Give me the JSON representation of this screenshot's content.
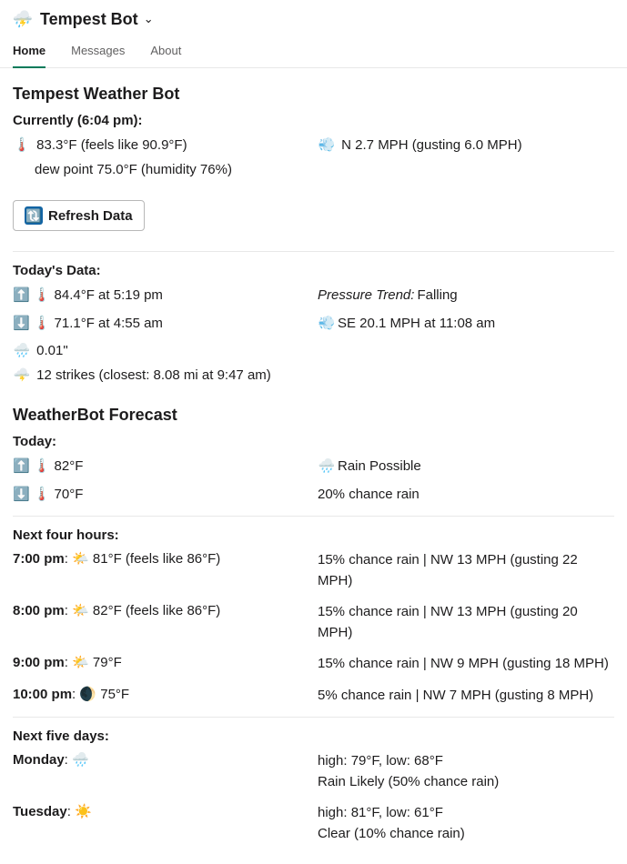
{
  "header": {
    "app_icon": "⛈️",
    "app_title": "Tempest Bot",
    "chevron": "⌄"
  },
  "tabs": [
    {
      "label": "Home",
      "active": true
    },
    {
      "label": "Messages",
      "active": false
    },
    {
      "label": "About",
      "active": false
    }
  ],
  "weather": {
    "title": "Tempest Weather Bot",
    "currently_label": "Currently (6:04 pm):",
    "current": {
      "temp_icon": "🌡️",
      "temp_line": "83.3°F (feels like 90.9°F)",
      "dew_line": "dew point 75.0°F (humidity 76%)",
      "wind_icon": "💨",
      "wind_line": "N 2.7 MPH (gusting 6.0 MPH)"
    },
    "refresh_label": "Refresh Data",
    "refresh_icon": "🔃",
    "todays_data_label": "Today's Data:",
    "today": {
      "hi_icons": "⬆️ 🌡️",
      "hi_text": "84.4°F at 5:19 pm",
      "lo_icons": "⬇️ 🌡️",
      "lo_text": "71.1°F at 4:55 am",
      "rain_icon": "🌧️",
      "rain_text": "0.01\"",
      "strike_icon": "🌩️",
      "strike_text": "12 strikes (closest: 8.08 mi at 9:47 am)",
      "pressure_label": "Pressure Trend:",
      "pressure_value": "Falling",
      "wind_icon": "💨",
      "wind_text": "SE 20.1 MPH at 11:08 am"
    }
  },
  "forecast": {
    "title": "WeatherBot Forecast",
    "today_label": "Today:",
    "today": {
      "hi_icons": "⬆️ 🌡️",
      "hi_text": "82°F",
      "lo_icons": "⬇️ 🌡️",
      "lo_text": "70°F",
      "cond_icon": "🌧️",
      "cond_text": "Rain Possible",
      "chance_text": "20% chance rain"
    },
    "next_hours_label": "Next four hours:",
    "hours": [
      {
        "time": "7:00 pm",
        "icon": "🌤️",
        "temp": "81°F (feels like 86°F)",
        "right": "15% chance rain | NW 13 MPH (gusting 22 MPH)"
      },
      {
        "time": "8:00 pm",
        "icon": "🌤️",
        "temp": "82°F (feels like 86°F)",
        "right": "15% chance rain | NW 13 MPH (gusting 20 MPH)"
      },
      {
        "time": "9:00 pm",
        "icon": "🌤️",
        "temp": "79°F",
        "right": "15% chance rain | NW 9 MPH (gusting 18 MPH)"
      },
      {
        "time": "10:00 pm",
        "icon": "🌒",
        "temp": "75°F",
        "right": "5% chance rain | NW 7 MPH (gusting 8 MPH)"
      }
    ],
    "next_days_label": "Next five days:",
    "days": [
      {
        "name": "Monday",
        "icon": "🌧️",
        "right1": "high: 79°F, low: 68°F",
        "right2": "Rain Likely (50% chance rain)"
      },
      {
        "name": "Tuesday",
        "icon": "☀️",
        "right1": "high: 81°F, low: 61°F",
        "right2": "Clear (10% chance rain)"
      }
    ]
  }
}
